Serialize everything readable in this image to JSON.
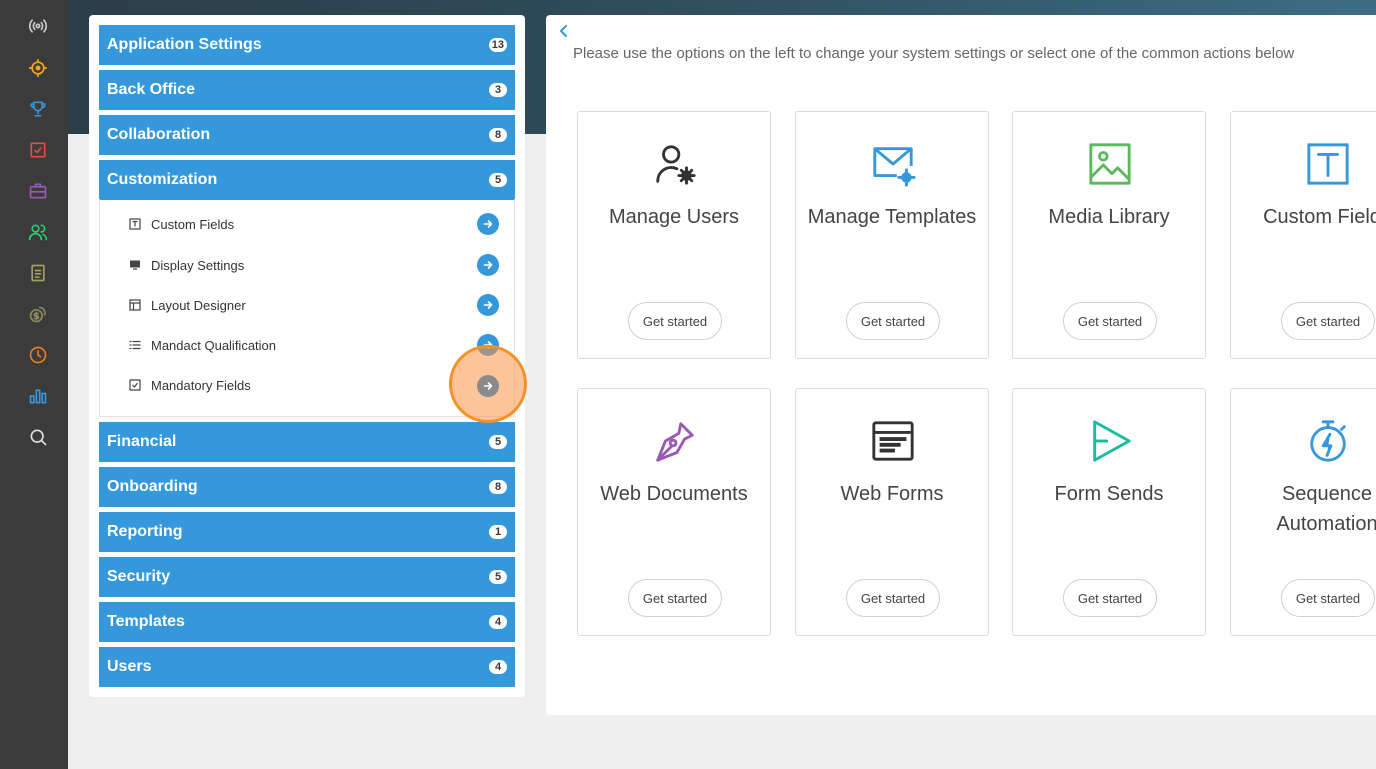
{
  "rail": {
    "icons": [
      {
        "name": "broadcast-icon",
        "color": "#cccccc"
      },
      {
        "name": "target-icon",
        "color": "#f5a623"
      },
      {
        "name": "trophy-icon",
        "color": "#3498db"
      },
      {
        "name": "checkbox-icon",
        "color": "#e74c3c"
      },
      {
        "name": "briefcase-icon",
        "color": "#9b59b6"
      },
      {
        "name": "users-icon",
        "color": "#2ecc71"
      },
      {
        "name": "document-icon",
        "color": "#a0a060"
      },
      {
        "name": "dollar-icon",
        "color": "#8a8a5a"
      },
      {
        "name": "clock-icon",
        "color": "#e67e22"
      },
      {
        "name": "bar-chart-icon",
        "color": "#3498db"
      },
      {
        "name": "search-icon",
        "color": "#dddddd"
      }
    ]
  },
  "sidebar": {
    "categories": [
      {
        "label": "Application Settings",
        "count": "13"
      },
      {
        "label": "Back Office",
        "count": "3"
      },
      {
        "label": "Collaboration",
        "count": "8"
      },
      {
        "label": "Customization",
        "count": "5"
      },
      {
        "label": "Financial",
        "count": "5"
      },
      {
        "label": "Onboarding",
        "count": "8"
      },
      {
        "label": "Reporting",
        "count": "1"
      },
      {
        "label": "Security",
        "count": "5"
      },
      {
        "label": "Templates",
        "count": "4"
      },
      {
        "label": "Users",
        "count": "4"
      }
    ],
    "customization_items": [
      {
        "label": "Custom Fields",
        "icon": "text-box-icon"
      },
      {
        "label": "Display Settings",
        "icon": "monitor-icon"
      },
      {
        "label": "Layout Designer",
        "icon": "layout-icon"
      },
      {
        "label": "Mandact Qualification",
        "icon": "list-icon"
      },
      {
        "label": "Mandatory Fields",
        "icon": "checkbox-icon"
      }
    ]
  },
  "main": {
    "intro": "Please use the options on the left to change your system settings or select one of the common actions below",
    "button_label": "Get started",
    "cards": [
      {
        "title": "Manage Users",
        "icon": "user-gear-icon",
        "color": "#333333"
      },
      {
        "title": "Manage Templates",
        "icon": "mail-gear-icon",
        "color": "#3498db"
      },
      {
        "title": "Media Library",
        "icon": "image-icon",
        "color": "#5cb85c"
      },
      {
        "title": "Custom Fields",
        "icon": "text-box-icon",
        "color": "#3498db"
      },
      {
        "title": "Web Documents",
        "icon": "pen-nib-icon",
        "color": "#9b59b6"
      },
      {
        "title": "Web Forms",
        "icon": "browser-window-icon",
        "color": "#333333"
      },
      {
        "title": "Form Sends",
        "icon": "send-icon",
        "color": "#1abc9c"
      },
      {
        "title": "Sequence Automation",
        "icon": "stopwatch-bolt-icon",
        "color": "#3498db"
      }
    ]
  }
}
